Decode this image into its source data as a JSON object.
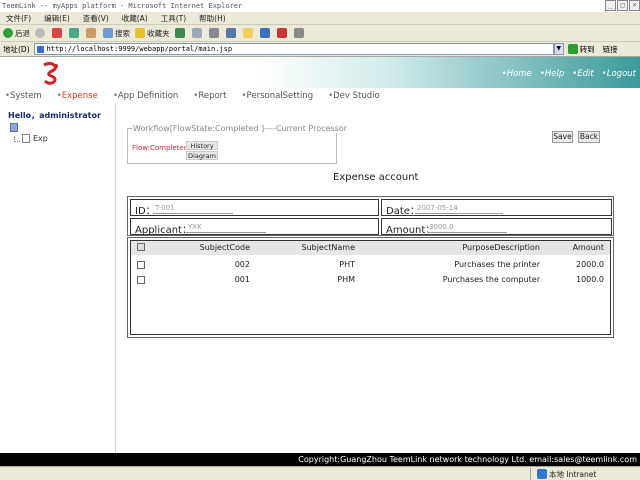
{
  "window": {
    "title": "TeemLink -- myApps platform - Microsoft Internet Explorer",
    "buttons": [
      "_",
      "□",
      "×"
    ]
  },
  "ie_menu": [
    "文件(F)",
    "编辑(E)",
    "查看(V)",
    "收藏(A)",
    "工具(T)",
    "帮助(H)"
  ],
  "ie_toolbar": {
    "back": "后退",
    "search": "搜索",
    "favorites": "收藏夹"
  },
  "address": {
    "label": "地址(D)",
    "url": "http://localhost:9999/webapp/portal/main.jsp",
    "go": "转到",
    "links": "链接"
  },
  "header": {
    "links": [
      "Home",
      "Help",
      "Edit",
      "Logout"
    ]
  },
  "nav": {
    "items": [
      "System",
      "Expense",
      "App Definition",
      "Report",
      "PersonalSetting",
      "Dev Studio"
    ],
    "active": "Expense"
  },
  "sidebar": {
    "greeting": "Hello，administrator",
    "tree_item": "Exp"
  },
  "workflow": {
    "legend": "Workflow[FlowState:Completed ]----Current Processor",
    "state": "Flow:Completed",
    "history_button": "History",
    "diagram_button": "Diagram"
  },
  "actions": {
    "save": "Save",
    "back": "Back"
  },
  "form": {
    "title": "Expense account",
    "id_label": "ID：",
    "id_value": "T-001",
    "date_label": "Date：",
    "date_value": "2007-05-14",
    "applicant_label": "Applicant：",
    "applicant_value": "YXK",
    "amount_label": "Amount：",
    "amount_value": "3000.0"
  },
  "table": {
    "headers": [
      "SubjectCode",
      "SubjectName",
      "PurposeDescription",
      "Amount"
    ],
    "rows": [
      [
        "002",
        "PHT",
        "Purchases the printer",
        "2000.0"
      ],
      [
        "001",
        "PHM",
        "Purchases the computer",
        "1000.0"
      ]
    ]
  },
  "footer": {
    "copyright": "Copyright:GuangZhou TeemLink network technology Ltd. email:sales@teemlink.com"
  },
  "status": {
    "zone": "本地 Intranet"
  }
}
